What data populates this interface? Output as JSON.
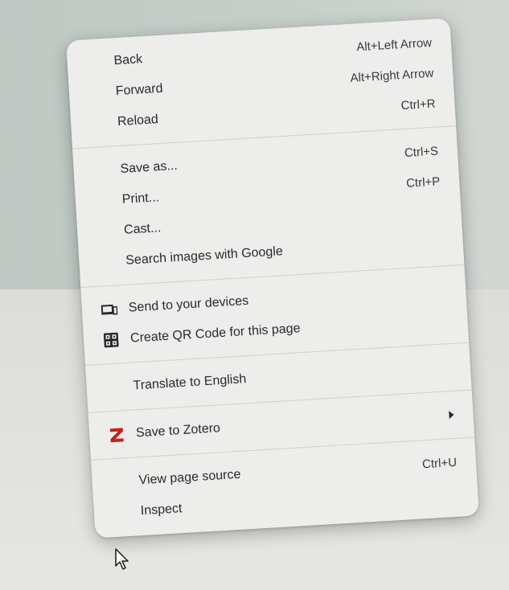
{
  "menu": {
    "groups": [
      {
        "items": [
          {
            "label": "Back",
            "shortcut": "Alt+Left Arrow"
          },
          {
            "label": "Forward",
            "shortcut": "Alt+Right Arrow"
          },
          {
            "label": "Reload",
            "shortcut": "Ctrl+R"
          }
        ]
      },
      {
        "items": [
          {
            "label": "Save as...",
            "shortcut": "Ctrl+S"
          },
          {
            "label": "Print...",
            "shortcut": "Ctrl+P"
          },
          {
            "label": "Cast...",
            "shortcut": ""
          },
          {
            "label": "Search images with Google",
            "shortcut": ""
          }
        ]
      },
      {
        "items": [
          {
            "label": "Send to your devices",
            "icon": "devices-icon"
          },
          {
            "label": "Create QR Code for this page",
            "icon": "qr-code-icon"
          }
        ]
      },
      {
        "items": [
          {
            "label": "Translate to English"
          }
        ]
      },
      {
        "items": [
          {
            "label": "Save to Zotero",
            "icon": "zotero-icon",
            "submenu": true
          }
        ]
      },
      {
        "items": [
          {
            "label": "View page source",
            "shortcut": "Ctrl+U"
          },
          {
            "label": "Inspect",
            "shortcut": ""
          }
        ]
      }
    ]
  },
  "colors": {
    "menu_bg": "#ededeb",
    "zotero_red": "#c4221b",
    "text": "#2a2a2a"
  },
  "icons": {
    "cursor": "mouse-pointer-icon"
  }
}
